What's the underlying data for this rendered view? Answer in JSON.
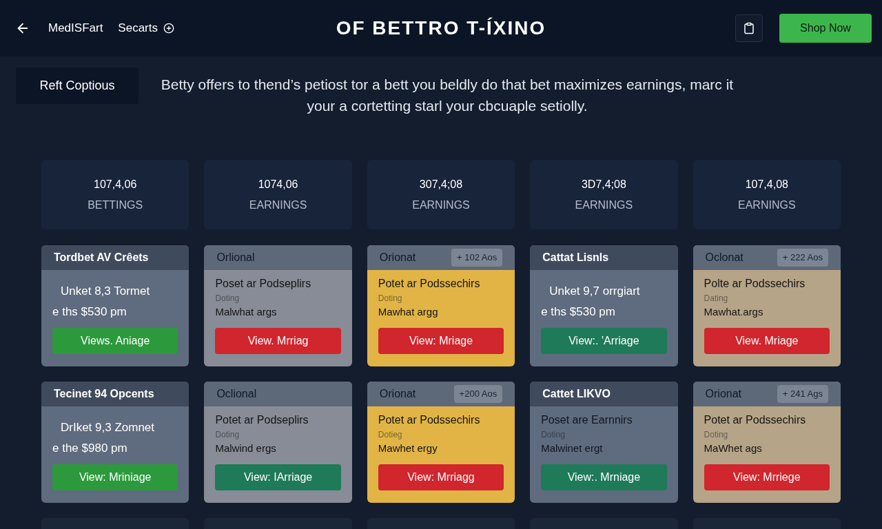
{
  "header": {
    "nav": [
      "MedISFart",
      "Secarts"
    ],
    "title": "OF BETTRO T-ÍXINO",
    "shop_button": "Shop Now"
  },
  "intro": {
    "button": "Reft Coptious",
    "text": "Betty offers to thend’s petiost tor a bett you beldly do that bet maximizes earnings, marc it your a cortetting starl your cbcuaple setiolly."
  },
  "stats": [
    {
      "value": "107,4,06",
      "label": "BETTINGS"
    },
    {
      "value": "1074,06",
      "label": "EARNINGS"
    },
    {
      "value": "307,4;08",
      "label": "EARNINGS"
    },
    {
      "value": "3D7,4;08",
      "label": "EARNINGS"
    },
    {
      "value": "107,4,08",
      "label": "EARNINGS"
    }
  ],
  "cards": [
    {
      "kind": "promo",
      "header": {
        "color": "#3f4b5d"
      },
      "title": "Tordbet AV Crêets",
      "color": "#5f6b7e",
      "lines": [
        "Unket 8,3 Tormet",
        "e ths $530 pm"
      ],
      "button": {
        "label": "Views. Aniage",
        "color": "#2c9a3c"
      }
    },
    {
      "kind": "detail",
      "header": {
        "color": "#5d6878"
      },
      "title": "Orlional",
      "color": "#878c96",
      "lines": [
        "Poset ar Podseplirs",
        "Doting",
        "Malwhat args"
      ],
      "button": {
        "label": "View. Mrriag",
        "color": "#d1262d"
      }
    },
    {
      "kind": "detail",
      "header": {
        "color": "#5d6878"
      },
      "title": "Orionat",
      "badge": "+ 102 Aos",
      "color": "#e1b445",
      "lines": [
        "Potet ar Podssechirs",
        "Doting",
        "Mawhat argg"
      ],
      "button": {
        "label": "View: Mriage",
        "color": "#d1262d"
      }
    },
    {
      "kind": "promo",
      "header": {
        "color": "#3f4b5d"
      },
      "title": "Cattat Lisnls",
      "color": "#5f6b7e",
      "lines": [
        "Unket 9,7 orrgiart",
        "e ths $530 pm"
      ],
      "button": {
        "label": "View:. 'Arriage",
        "color": "#1f7a5a"
      }
    },
    {
      "kind": "detail",
      "header": {
        "color": "#5d6878"
      },
      "title": "Oclonat",
      "badge": "+ 222 Aos",
      "color": "#b6a488",
      "lines": [
        "Polte ar Podssechirs",
        "Dating",
        "Mawhat.args"
      ],
      "button": {
        "label": "View. Mriage",
        "color": "#d1262d"
      }
    },
    {
      "kind": "promo",
      "header": {
        "color": "#3f4b5d"
      },
      "title": "Tecinet 94 Opcents",
      "color": "#5f6b7e",
      "lines": [
        "DrIket 9,3 Zomnet",
        "e the $980 pm"
      ],
      "button": {
        "label": "View: Mriniage",
        "color": "#2c9a3c"
      }
    },
    {
      "kind": "detail",
      "header": {
        "color": "#5d6878"
      },
      "title": "Oclional",
      "color": "#878c96",
      "lines": [
        "Potet ar Podseplirs",
        "Doting",
        "Malwind ergs"
      ],
      "button": {
        "label": "View: IArriage",
        "color": "#1f7a5a"
      }
    },
    {
      "kind": "detail",
      "header": {
        "color": "#5d6878"
      },
      "title": "Orionat",
      "badge": "+200 Aos",
      "color": "#e1b445",
      "lines": [
        "Potet ar Podssechirs",
        "Dotieg",
        "Mawhet ergy"
      ],
      "button": {
        "label": "View: Mrriagg",
        "color": "#d1262d"
      }
    },
    {
      "kind": "detail",
      "header": {
        "color": "#3f4b5d"
      },
      "title": "Cattet LIKVO",
      "color": "#5f6b7e",
      "lines": [
        "Poset are Earnnirs",
        "Doting",
        "Malwinet ergt"
      ],
      "button": {
        "label": "View:. Mrniage",
        "color": "#1f7a5a"
      }
    },
    {
      "kind": "detail",
      "header": {
        "color": "#5d6878"
      },
      "title": "Orionat",
      "badge": "+ 241 Ags",
      "color": "#b6a488",
      "lines": [
        "Potet ar Podssechirs",
        "Doting",
        "MaWhet ags"
      ],
      "button": {
        "label": "View: Mrriege",
        "color": "#d1262d"
      }
    }
  ]
}
